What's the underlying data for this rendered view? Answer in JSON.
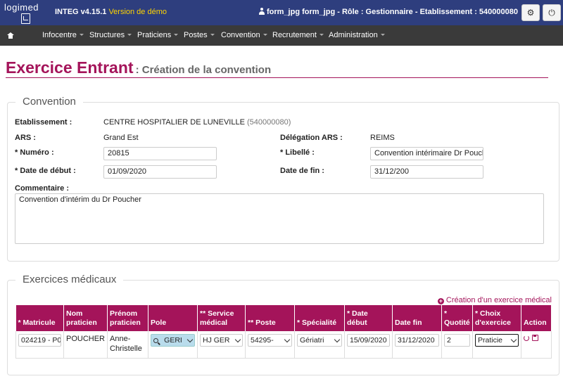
{
  "app": {
    "logo_text": "logimed",
    "title": "INTEG v4.15.1",
    "demo_label": "Version de démo",
    "user_info": "form_jpg form_jpg - Rôle : Gestionnaire - Etablissement : 540000080"
  },
  "nav": {
    "items": [
      {
        "label": "Infocentre"
      },
      {
        "label": "Structures"
      },
      {
        "label": "Praticiens"
      },
      {
        "label": "Postes"
      },
      {
        "label": "Convention"
      },
      {
        "label": "Recrutement"
      },
      {
        "label": "Administration"
      }
    ]
  },
  "page": {
    "title": "Exercice Entrant",
    "subtitle": ": Création de la convention"
  },
  "convention": {
    "legend": "Convention",
    "etablissement_label": "Etablissement :",
    "etablissement_value": "CENTRE HOSPITALIER DE LUNEVILLE",
    "etablissement_code": "(540000080)",
    "ars_label": "ARS :",
    "ars_value": "Grand Est",
    "delegation_label": "Délégation ARS :",
    "delegation_value": "REIMS",
    "numero_label": "* Numéro :",
    "numero_value": "20815",
    "libelle_label": "* Libellé :",
    "libelle_value": "Convention intérimaire Dr Poucher",
    "date_debut_label": "* Date de début :",
    "date_debut_value": "01/09/2020",
    "date_fin_label": "Date de fin :",
    "date_fin_value": "31/12/200",
    "commentaire_label": "Commentaire :",
    "commentaire_value": "Convention d'intérim du Dr Poucher"
  },
  "exercices": {
    "legend": "Exercices médicaux",
    "add_link": "Création d'un exercice médical",
    "headers": {
      "matricule": "* Matricule",
      "nom": "Nom praticien",
      "prenom": "Prénom praticien",
      "pole": "Pole",
      "service": "** Service médical",
      "poste": "** Poste",
      "specialite": "* Spécialité",
      "date_debut": "* Date début",
      "date_fin": "Date fin",
      "quotite": "* Quotité",
      "choix": "* Choix d'exercice",
      "action": "Action"
    },
    "row": {
      "matricule": "024219 - P0",
      "nom": "POUCHER",
      "prenom": "Anne-Christelle",
      "pole": "GERI",
      "service": "HJ GER",
      "poste": "54295-",
      "specialite": "Gériatri",
      "date_debut": "15/09/2020",
      "date_fin": "31/12/2020",
      "quotite": "2",
      "choix": "Praticie"
    }
  }
}
